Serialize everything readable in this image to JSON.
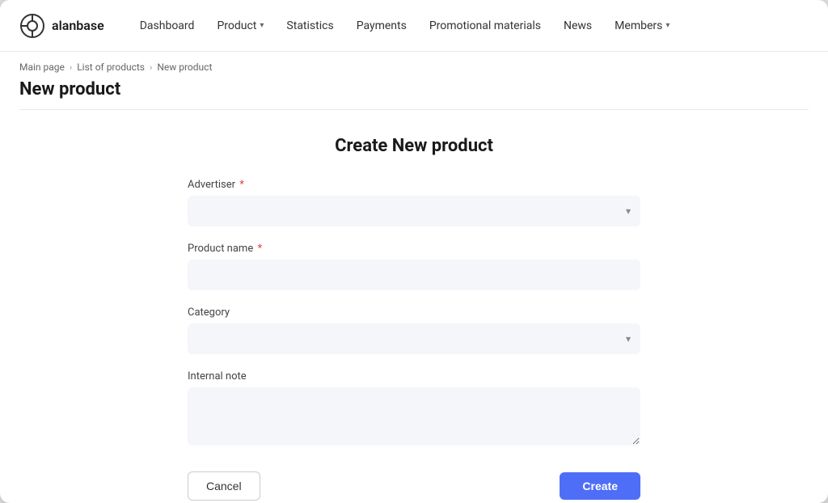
{
  "logo": {
    "text": "alanbase"
  },
  "nav": {
    "items": [
      {
        "id": "dashboard",
        "label": "Dashboard",
        "hasDropdown": false
      },
      {
        "id": "product",
        "label": "Product",
        "hasDropdown": true
      },
      {
        "id": "statistics",
        "label": "Statistics",
        "hasDropdown": false
      },
      {
        "id": "payments",
        "label": "Payments",
        "hasDropdown": false
      },
      {
        "id": "promotional-materials",
        "label": "Promotional materials",
        "hasDropdown": false
      },
      {
        "id": "news",
        "label": "News",
        "hasDropdown": false
      },
      {
        "id": "members",
        "label": "Members",
        "hasDropdown": true
      }
    ]
  },
  "breadcrumb": {
    "items": [
      {
        "label": "Main page",
        "href": "#"
      },
      {
        "label": "List of products",
        "href": "#"
      },
      {
        "label": "New product",
        "href": "#"
      }
    ]
  },
  "page": {
    "title": "New product"
  },
  "form": {
    "title": "Create New product",
    "fields": {
      "advertiser": {
        "label": "Advertiser",
        "required": true,
        "placeholder": ""
      },
      "product_name": {
        "label": "Product name",
        "required": true,
        "placeholder": ""
      },
      "category": {
        "label": "Category",
        "required": false,
        "placeholder": ""
      },
      "internal_note": {
        "label": "Internal note",
        "required": false,
        "placeholder": ""
      }
    },
    "buttons": {
      "cancel": "Cancel",
      "create": "Create"
    }
  }
}
